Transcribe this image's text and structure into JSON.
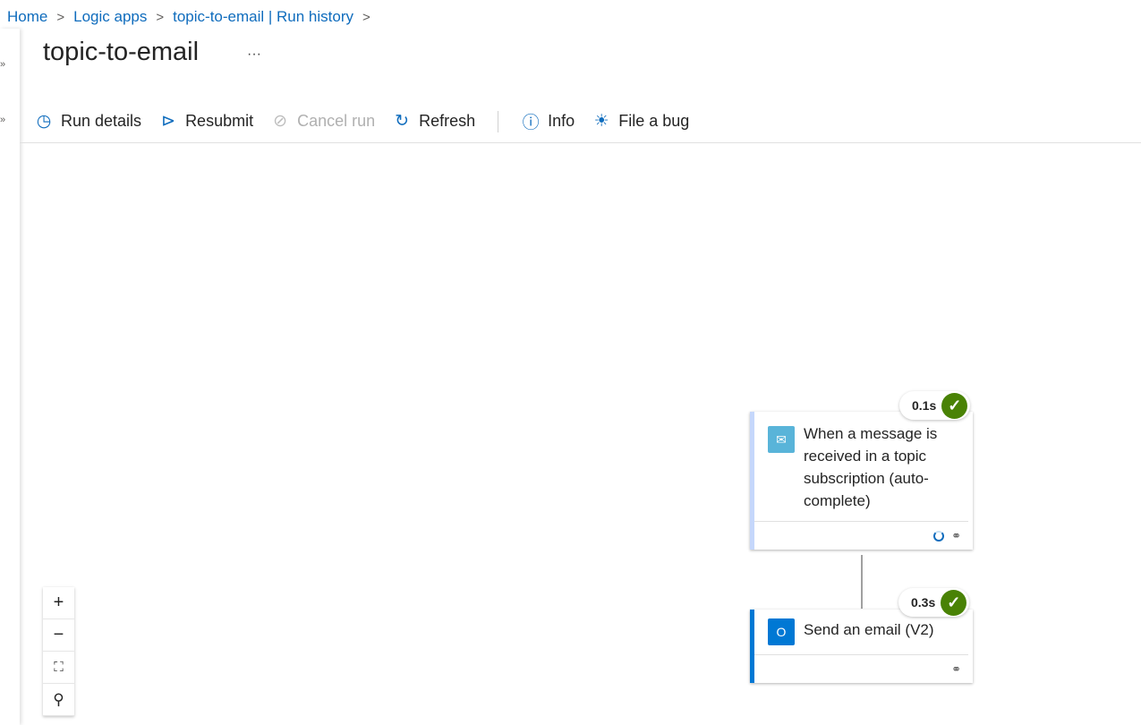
{
  "breadcrumb": [
    "Home",
    "Logic apps",
    "topic-to-email | Run history"
  ],
  "page_title": "topic-to-email",
  "toolbar": {
    "run_details": "Run details",
    "resubmit": "Resubmit",
    "cancel_run": "Cancel run",
    "refresh": "Refresh",
    "info": "Info",
    "file_bug": "File a bug"
  },
  "workflow": {
    "trigger": {
      "title": "When a message is received in a topic subscription (auto-complete)",
      "duration": "0.1s",
      "status": "succeeded",
      "color": "#c5d7fb"
    },
    "action": {
      "title": "Send an email (V2)",
      "duration": "0.3s",
      "status": "succeeded",
      "color": "#0078d4"
    }
  }
}
